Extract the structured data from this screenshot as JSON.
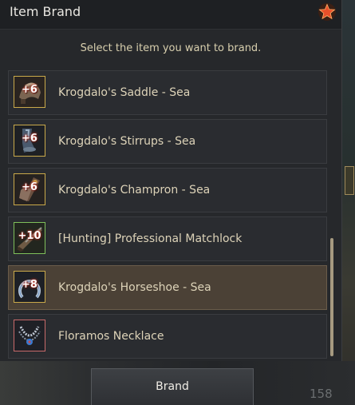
{
  "window": {
    "title": "Item Brand",
    "subtitle": "Select the item you want to brand."
  },
  "items": [
    {
      "label": "Krogdalo's Saddle - Sea",
      "enhancement": "+6",
      "icon": "saddle-icon",
      "selected": false
    },
    {
      "label": "Krogdalo's Stirrups - Sea",
      "enhancement": "+6",
      "icon": "stirrups-icon",
      "selected": false
    },
    {
      "label": "Krogdalo's Champron - Sea",
      "enhancement": "+6",
      "icon": "champron-icon",
      "selected": false
    },
    {
      "label": "[Hunting] Professional Matchlock",
      "enhancement": "+10",
      "icon": "matchlock-icon",
      "selected": false
    },
    {
      "label": "Krogdalo's Horseshoe - Sea",
      "enhancement": "+8",
      "icon": "horseshoe-icon",
      "selected": true
    },
    {
      "label": "Floramos Necklace",
      "enhancement": "",
      "icon": "necklace-icon",
      "selected": false
    }
  ],
  "footer": {
    "brand_label": "Brand",
    "background_number": "158"
  },
  "colors": {
    "accent_gold": "#c9a94a",
    "selected_row": "#4b4136",
    "label_text": "#ddd3b8"
  }
}
